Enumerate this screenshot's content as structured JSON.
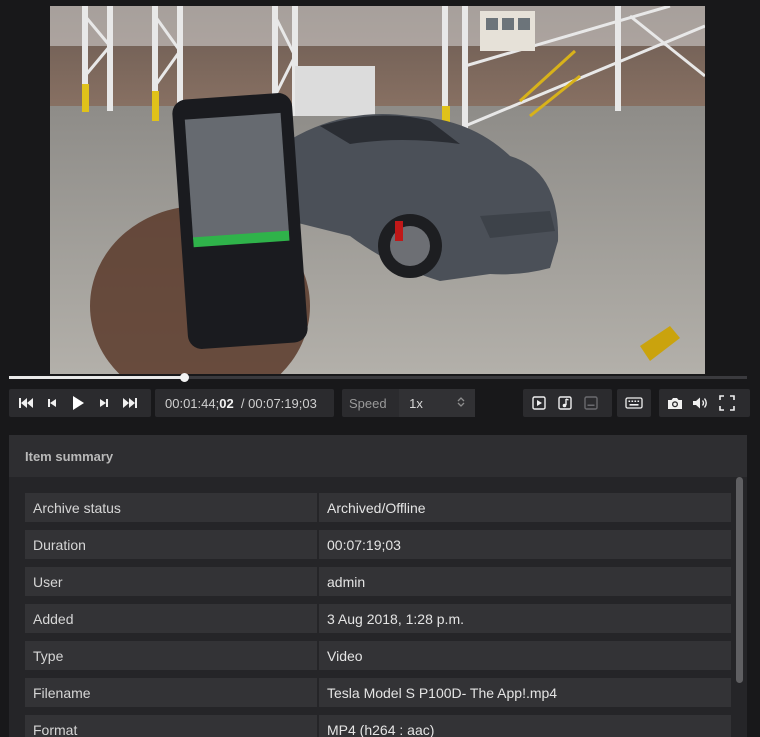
{
  "player": {
    "progress_fraction": 0.237,
    "current_time_prefix": "00:01:44;",
    "current_time_frames": "02",
    "total_time": "/ 00:07:19;03",
    "speed_label": "Speed",
    "speed_value": "1x"
  },
  "icons": {
    "skip_start": "skip-to-start-icon",
    "step_back": "step-back-icon",
    "play": "play-icon",
    "step_forward": "step-forward-icon",
    "skip_end": "skip-to-end-icon",
    "video_track": "video-track-icon",
    "audio_track": "music-note-icon",
    "subtitles": "subtitles-icon",
    "keyboard": "keyboard-icon",
    "camera": "camera-icon",
    "volume": "volume-icon",
    "fullscreen": "fullscreen-icon"
  },
  "summary": {
    "title": "Item summary",
    "rows": [
      {
        "label": "Archive status",
        "value": "Archived/Offline"
      },
      {
        "label": "Duration",
        "value": "00:07:19;03"
      },
      {
        "label": "User",
        "value": "admin"
      },
      {
        "label": "Added",
        "value": "3 Aug 2018, 1:28 p.m."
      },
      {
        "label": "Type",
        "value": "Video"
      },
      {
        "label": "Filename",
        "value": "Tesla Model S P100D- The App!.mp4"
      },
      {
        "label": "Format",
        "value": "MP4 (h264 : aac)"
      }
    ]
  },
  "colors": {
    "background": "#18181a",
    "panel": "#252528",
    "row": "#333336",
    "scrub_fill": "#e9e9e9"
  }
}
